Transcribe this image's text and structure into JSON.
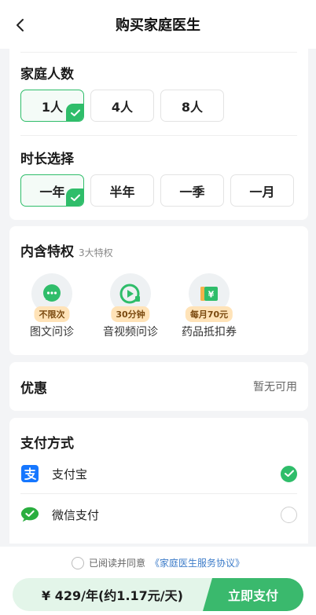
{
  "header": {
    "title": "购买家庭医生"
  },
  "family": {
    "title": "家庭人数",
    "options": [
      "1人",
      "4人",
      "8人"
    ],
    "selected": 0
  },
  "duration": {
    "title": "时长选择",
    "options": [
      "一年",
      "半年",
      "一季",
      "一月"
    ],
    "selected": 0
  },
  "privileges": {
    "title": "内含特权",
    "subtitle": "3大特权",
    "items": [
      {
        "badge": "不限次",
        "label": "图文问诊",
        "icon": "chat-bubble-icon"
      },
      {
        "badge": "30分钟",
        "label": "音视频问诊",
        "icon": "video-call-icon"
      },
      {
        "badge": "每月70元",
        "label": "药品抵扣券",
        "icon": "coupon-icon"
      }
    ]
  },
  "discount": {
    "title": "优惠",
    "value": "暂无可用"
  },
  "payment": {
    "title": "支付方式",
    "methods": [
      {
        "label": "支付宝",
        "icon": "alipay-icon",
        "selected": true
      },
      {
        "label": "微信支付",
        "icon": "wechat-pay-icon",
        "selected": false
      }
    ]
  },
  "footer": {
    "agree_text": "已阅读并同意",
    "agreement_link": "《家庭医生服务协议》",
    "price": "¥ 429/年(约1.17元/天)",
    "pay_button": "立即支付"
  },
  "colors": {
    "accent": "#2fbd6a",
    "alipay": "#1677ff",
    "wechat": "#2aae3f",
    "badge": "#ffe3b8",
    "link": "#3d7cc9"
  }
}
